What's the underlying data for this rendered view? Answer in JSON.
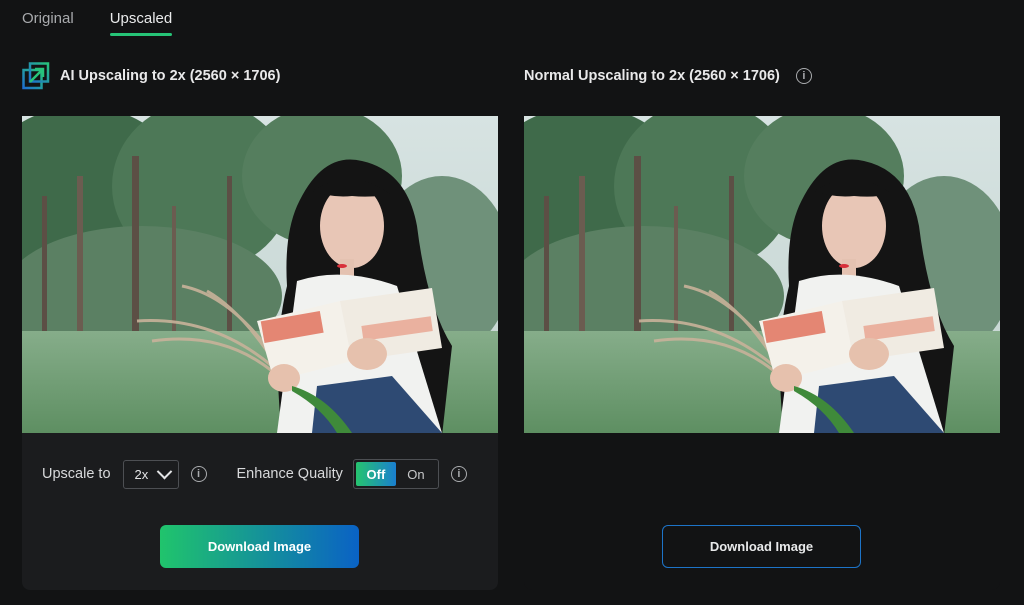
{
  "tabs": [
    {
      "label": "Original",
      "active": false
    },
    {
      "label": "Upscaled",
      "active": true
    }
  ],
  "left_panel": {
    "title": "AI Upscaling to 2x (2560 × 1706)",
    "icon": "upscale-arrow-icon",
    "upscale_label": "Upscale to",
    "upscale_value": "2x",
    "enhance_label": "Enhance Quality",
    "toggle_off": "Off",
    "toggle_on": "On",
    "toggle_state": "Off",
    "download_label": "Download Image"
  },
  "right_panel": {
    "title": "Normal Upscaling to 2x (2560 × 1706)",
    "download_label": "Download Image"
  },
  "colors": {
    "accent_green": "#26c477",
    "accent_blue": "#0a62c5",
    "background": "#121314"
  },
  "info_glyph": "i"
}
